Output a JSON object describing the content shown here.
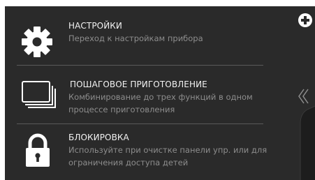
{
  "menu": {
    "items": [
      {
        "title": "НАСТРОЙКИ",
        "description": "Переход к настройкам прибора",
        "icon": "gear-icon"
      },
      {
        "title": "ПОШАГОВОЕ ПРИГОТОВЛЕНИЕ",
        "description": "Комбинирование до трех функций в одном процессе приготовления",
        "icon": "stacked-steps-icon"
      },
      {
        "title": "БЛОКИРОВКА",
        "description": "Используйте при очистке панели упр. или для ограничения доступа детей",
        "icon": "lock-icon"
      }
    ]
  },
  "sidebar": {
    "add_icon": "plus-circle-icon",
    "expand_icon": "double-chevron-left-icon"
  },
  "colors": {
    "background": "#2a2a2a",
    "title": "#f2f2f2",
    "description": "#8d8d8d",
    "divider": "#5a5a5a",
    "icon": "#ffffff"
  }
}
